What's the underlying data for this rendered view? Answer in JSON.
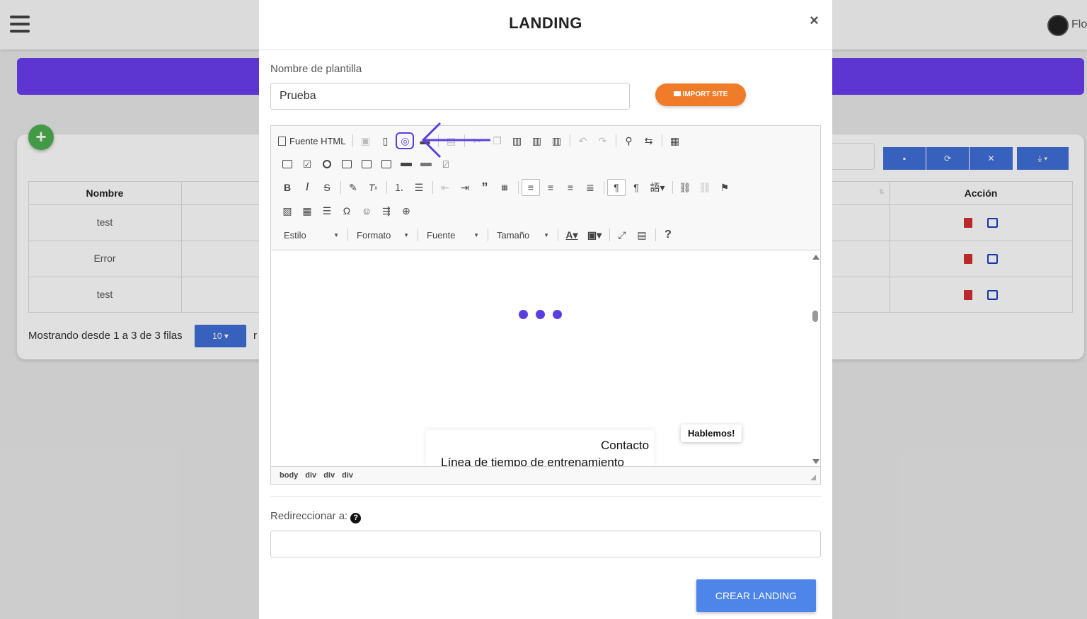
{
  "app": {
    "user_name": "Flo"
  },
  "table": {
    "headers": {
      "name": "Nombre",
      "action": "Acción"
    },
    "rows": [
      {
        "name": "test"
      },
      {
        "name": "Error"
      },
      {
        "name": "test"
      }
    ],
    "footer_text": "Mostrando desde 1 a 3 de 3 filas",
    "page_size": "10 ▾",
    "footer_trail": "r"
  },
  "modal": {
    "title": "LANDING",
    "close_label": "×",
    "template_name_label": "Nombre de plantilla",
    "template_name_value": "Prueba",
    "import_button": "IMPORT SITE",
    "redirect_label": "Redireccionar a:",
    "redirect_help": "?",
    "redirect_value": "",
    "submit_button": "CREAR LANDING"
  },
  "editor": {
    "source_button": "Fuente HTML",
    "combos": {
      "style": "Estilo",
      "format": "Formato",
      "font": "Fuente",
      "size": "Tamaño"
    },
    "content": {
      "floating_button": "Hablemos!",
      "contact_text": "Contacto",
      "timeline_text": "Línea de tiempo de entrenamiento"
    },
    "path": [
      "body",
      "div",
      "div",
      "div"
    ]
  },
  "colors": {
    "brand_purple": "#6a3ef0",
    "import_orange": "#f07c2a",
    "submit_blue": "#4d85e8",
    "toolbar_blue": "#3f6fd8"
  }
}
